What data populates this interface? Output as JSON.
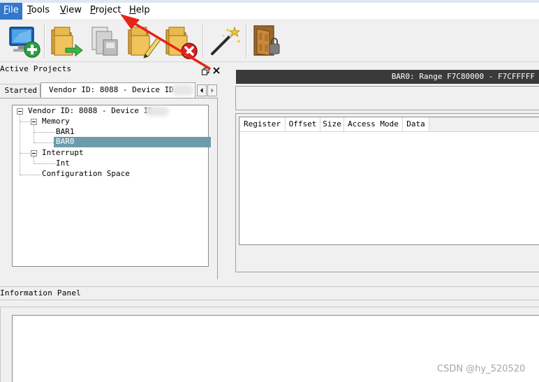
{
  "menu": {
    "file": {
      "accel": "F",
      "rest": "ile"
    },
    "tools": {
      "accel": "T",
      "rest": "ools"
    },
    "view": {
      "accel": "V",
      "rest": "iew"
    },
    "project": {
      "accel": "P",
      "rest": "roject"
    },
    "help": {
      "accel": "H",
      "rest": "elp"
    }
  },
  "toolbar": {
    "buttons": [
      "new-project-icon",
      "export-icon",
      "copy-document-icon",
      "edit-folder-icon",
      "delete-folder-icon",
      "magic-wand-icon",
      "open-door-icon"
    ]
  },
  "left_panel": {
    "title": "Active Projects",
    "tabs": {
      "started": "Started",
      "device": "Vendor ID: 8088 - Device ID:"
    },
    "tree": {
      "root": "Vendor ID: 8088 - Device ID:",
      "memory": "Memory",
      "bar1": "BAR1",
      "bar0": "BAR0",
      "interrupt": "Interrupt",
      "int": "Int",
      "config": "Configuration Space"
    }
  },
  "right_panel": {
    "range_title": "BAR0: Range F7C80000 - F7CFFFFF",
    "columns": [
      "Register",
      "Offset",
      "Size",
      "Access Mode",
      "Data"
    ]
  },
  "info_panel": {
    "title": "Information Panel"
  },
  "watermark": "CSDN @hy_520520",
  "colors": {
    "selection": "#6e9bab",
    "menu_active": "#3377cc",
    "arrow": "#e8231a",
    "range_bar": "#3a3a3a"
  }
}
